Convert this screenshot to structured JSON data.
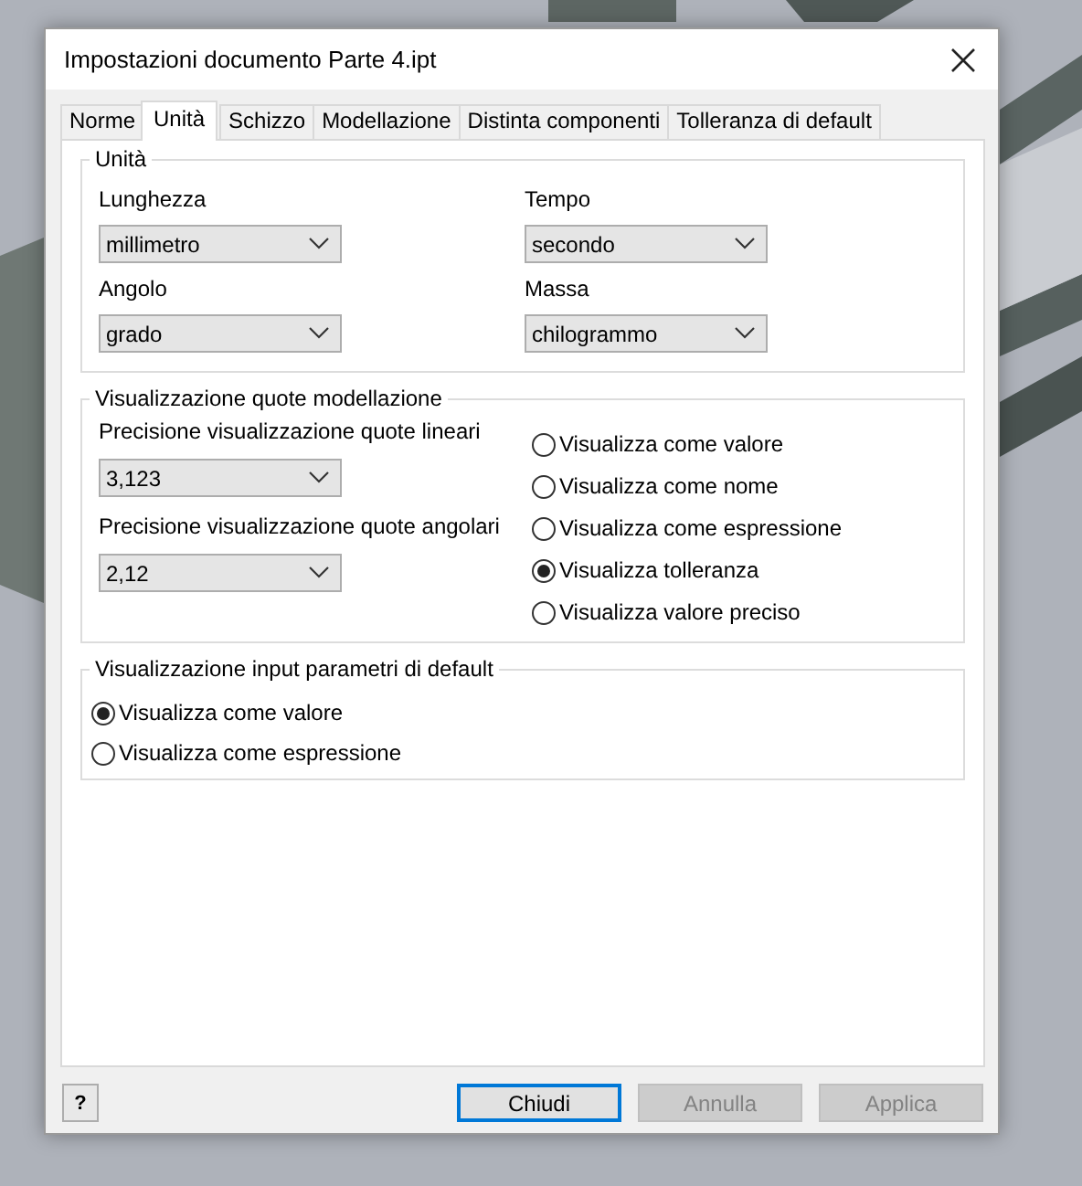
{
  "window": {
    "title": "Impostazioni documento Parte 4.ipt"
  },
  "tabs": [
    {
      "label": "Norme",
      "selected": false
    },
    {
      "label": "Unità",
      "selected": true
    },
    {
      "label": "Schizzo",
      "selected": false
    },
    {
      "label": "Modellazione",
      "selected": false
    },
    {
      "label": "Distinta componenti",
      "selected": false
    },
    {
      "label": "Tolleranza di default",
      "selected": false
    }
  ],
  "units_group": {
    "title": "Unità",
    "fields": [
      {
        "label": "Lunghezza",
        "value": "millimetro"
      },
      {
        "label": "Tempo",
        "value": "secondo"
      },
      {
        "label": "Angolo",
        "value": "grado"
      },
      {
        "label": "Massa",
        "value": "chilogrammo"
      }
    ]
  },
  "dimension_group": {
    "title": "Visualizzazione quote modellazione",
    "fields": [
      {
        "label": "Precisione visualizzazione quote lineari",
        "value": "3,123"
      },
      {
        "label": "Precisione visualizzazione quote angolari",
        "value": "2,12"
      }
    ],
    "options": [
      {
        "label": "Visualizza come valore",
        "selected": false
      },
      {
        "label": "Visualizza come nome",
        "selected": false
      },
      {
        "label": "Visualizza come espressione",
        "selected": false
      },
      {
        "label": "Visualizza tolleranza",
        "selected": true
      },
      {
        "label": "Visualizza valore preciso",
        "selected": false
      }
    ]
  },
  "input_group": {
    "title": "Visualizzazione input parametri di default",
    "options": [
      {
        "label": "Visualizza come valore",
        "selected": true
      },
      {
        "label": "Visualizza come espressione",
        "selected": false
      }
    ]
  },
  "help_button": {
    "label": "?"
  },
  "buttons": [
    {
      "label": "Chiudi",
      "default": true,
      "disabled": false
    },
    {
      "label": "Annulla",
      "default": false,
      "disabled": true
    },
    {
      "label": "Applica",
      "default": false,
      "disabled": true
    }
  ]
}
